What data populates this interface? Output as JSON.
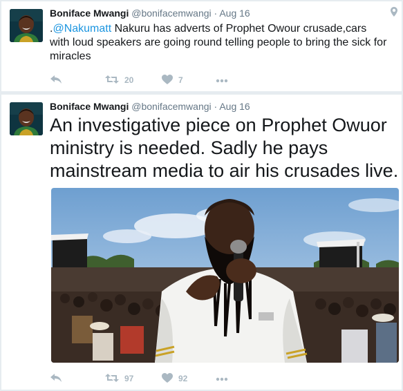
{
  "tweets": [
    {
      "name": "Boniface Mwangi",
      "handle": "@bonifacemwangi",
      "separator": "·",
      "date": "Aug 16",
      "text_prefix": ".",
      "mention": "@Nakumatt",
      "text": " Nakuru has adverts of Prophet Owour crusade,cars with loud speakers are going round telling people to bring the sick for miracles",
      "retweets": "20",
      "likes": "7"
    },
    {
      "name": "Boniface Mwangi",
      "handle": "@bonifacemwangi",
      "separator": "·",
      "date": "Aug 16",
      "text": "An investigative piece on Prophet Owuor ministry is needed. Sadly he pays mainstream media to air his crusades live.",
      "retweets": "97",
      "likes": "92"
    }
  ],
  "colors": {
    "link": "#1b95e0",
    "muted": "#657786",
    "icon": "#aab8c2",
    "background": "#e6ecf0"
  },
  "icons": [
    "location-pin-icon",
    "reply-icon",
    "retweet-icon",
    "heart-icon",
    "more-icon"
  ]
}
